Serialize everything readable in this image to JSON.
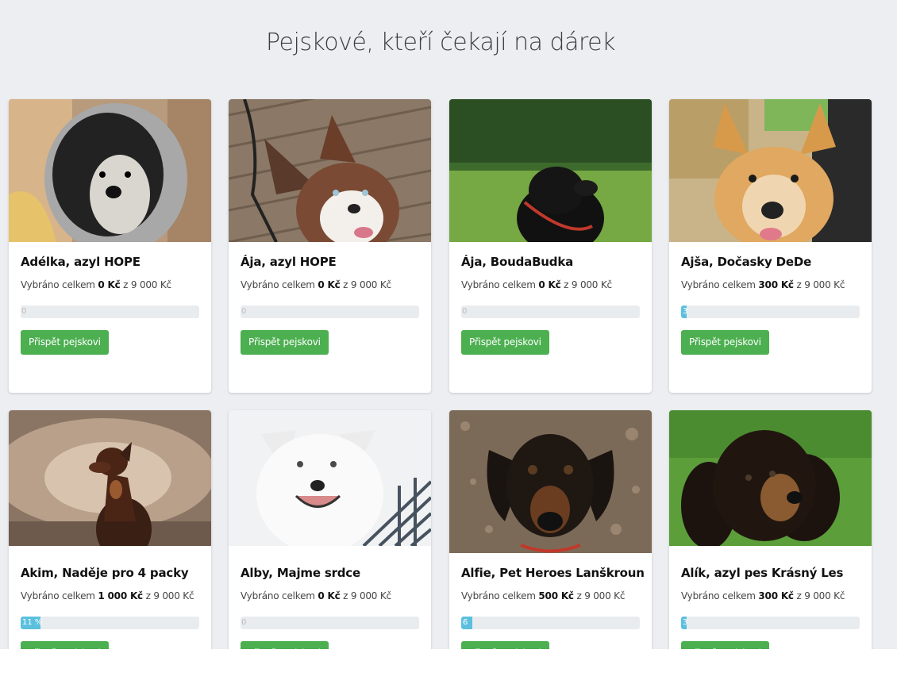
{
  "page": {
    "title": "Pejskové, kteří čekají na dárek"
  },
  "colors": {
    "background": "#eceef1",
    "button": "#4caf50",
    "progress": "#5bc0de"
  },
  "raised_prefix": "Vybráno celkem",
  "raised_of": "z",
  "button_label": "Přispět pejskovi",
  "dogs": [
    {
      "name": "Adélka, azyl HOPE",
      "raised": "0 Kč",
      "goal": "9 000 Kč",
      "progress": 0,
      "progress_label": "0"
    },
    {
      "name": "Ája, azyl HOPE",
      "raised": "0 Kč",
      "goal": "9 000 Kč",
      "progress": 0,
      "progress_label": "0"
    },
    {
      "name": "Ája, BoudaBudka",
      "raised": "0 Kč",
      "goal": "9 000 Kč",
      "progress": 0,
      "progress_label": "0"
    },
    {
      "name": "Ajša, Dočasky DeDe",
      "raised": "300 Kč",
      "goal": "9 000 Kč",
      "progress": 3,
      "progress_label": "3"
    },
    {
      "name": "Akim, Naděje pro 4 packy",
      "raised": "1 000 Kč",
      "goal": "9 000 Kč",
      "progress": 11,
      "progress_label": "11 %"
    },
    {
      "name": "Alby, Majme srdce",
      "raised": "0 Kč",
      "goal": "9 000 Kč",
      "progress": 0,
      "progress_label": "0"
    },
    {
      "name": "Alfie, Pet Heroes Lanškroun",
      "raised": "500 Kč",
      "goal": "9 000 Kč",
      "progress": 6,
      "progress_label": "6"
    },
    {
      "name": "Alík, azyl pes Krásný Les",
      "raised": "300 Kč",
      "goal": "9 000 Kč",
      "progress": 3,
      "progress_label": "3"
    }
  ]
}
